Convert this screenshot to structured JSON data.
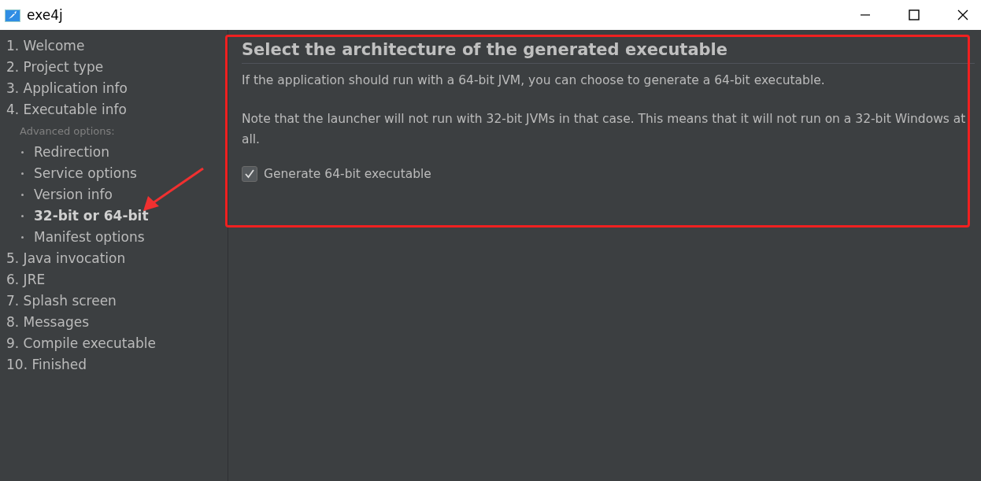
{
  "window": {
    "title": "exe4j"
  },
  "steps": [
    {
      "label": "1. Welcome",
      "selected": false
    },
    {
      "label": "2. Project type",
      "selected": false
    },
    {
      "label": "3. Application info",
      "selected": false
    },
    {
      "label": "4. Executable info",
      "selected": false,
      "section_label": "Advanced options:",
      "children": [
        {
          "label": "Redirection",
          "selected": false
        },
        {
          "label": "Service options",
          "selected": false
        },
        {
          "label": "Version info",
          "selected": false
        },
        {
          "label": "32-bit or 64-bit",
          "selected": true
        },
        {
          "label": "Manifest options",
          "selected": false
        }
      ]
    },
    {
      "label": "5. Java invocation",
      "selected": false
    },
    {
      "label": "6. JRE",
      "selected": false
    },
    {
      "label": "7. Splash screen",
      "selected": false
    },
    {
      "label": "8. Messages",
      "selected": false
    },
    {
      "label": "9. Compile executable",
      "selected": false
    },
    {
      "label": "10. Finished",
      "selected": false
    }
  ],
  "content": {
    "heading": "Select the architecture of the generated executable",
    "paragraphs": [
      "If the application should run with a 64-bit JVM, you can choose to generate a 64-bit executable.",
      "Note that the launcher will not run with 32-bit JVMs in that case. This means that it will not run on a 32-bit Windows at all."
    ],
    "checkbox": {
      "label": "Generate 64-bit executable",
      "checked": true
    }
  }
}
